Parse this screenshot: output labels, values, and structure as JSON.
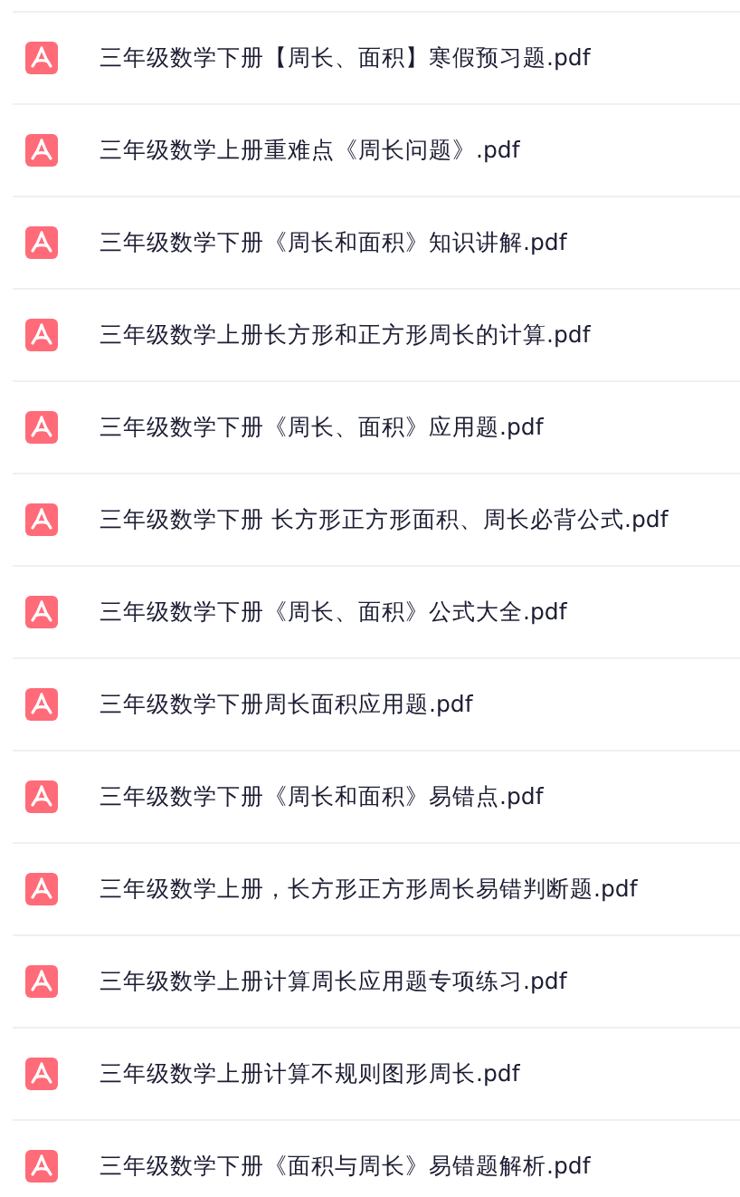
{
  "files": [
    {
      "name": "三年级数学下册【周长、面积】寒假预习题.pdf"
    },
    {
      "name": "三年级数学上册重难点《周长问题》.pdf"
    },
    {
      "name": "三年级数学下册《周长和面积》知识讲解.pdf"
    },
    {
      "name": "三年级数学上册长方形和正方形周长的计算.pdf"
    },
    {
      "name": "三年级数学下册《周长、面积》应用题.pdf"
    },
    {
      "name": "三年级数学下册 长方形正方形面积、周长必背公式.pdf"
    },
    {
      "name": "三年级数学下册《周长、面积》公式大全.pdf"
    },
    {
      "name": "三年级数学下册周长面积应用题.pdf"
    },
    {
      "name": "三年级数学下册《周长和面积》易错点.pdf"
    },
    {
      "name": "三年级数学上册，长方形正方形周长易错判断题.pdf"
    },
    {
      "name": "三年级数学上册计算周长应用题专项练习.pdf"
    },
    {
      "name": "三年级数学上册计算不规则图形周长.pdf"
    },
    {
      "name": "三年级数学下册《面积与周长》易错题解析.pdf"
    }
  ]
}
